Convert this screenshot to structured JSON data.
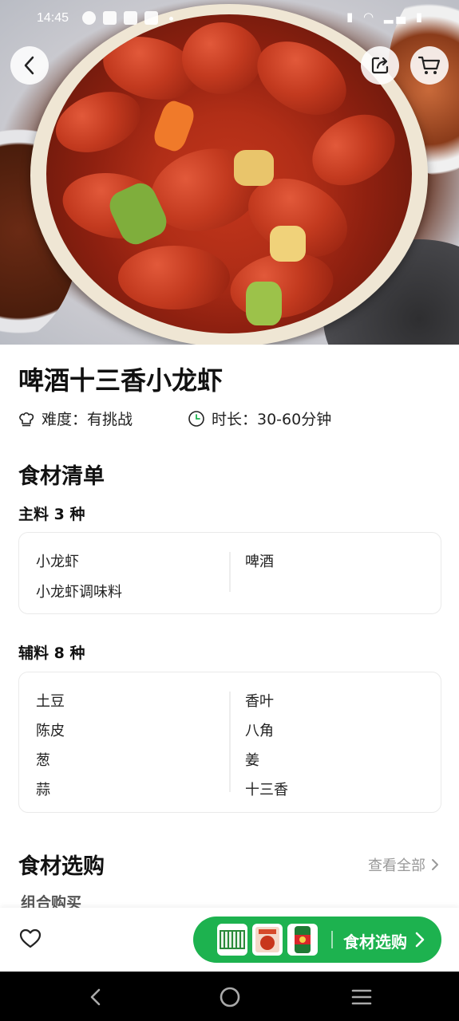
{
  "status_bar": {
    "time": "14:45"
  },
  "recipe": {
    "title": "啤酒十三香小龙虾",
    "difficulty_label": "难度：有挑战",
    "duration_label": "时长：30-60分钟"
  },
  "ingredients": {
    "section_title": "食材清单",
    "main": {
      "title": "主料 3 种",
      "items": [
        "小龙虾",
        "啤酒",
        "小龙虾调味料"
      ]
    },
    "auxiliary": {
      "title": "辅料 8 种",
      "items": [
        "土豆",
        "香叶",
        "陈皮",
        "八角",
        "葱",
        "姜",
        "蒜",
        "十三香"
      ]
    }
  },
  "shopping": {
    "section_title": "食材选购",
    "view_all": "查看全部",
    "subtitle": "组合购买"
  },
  "bottom_bar": {
    "buy_button_label": "食材选购",
    "accent_color": "#1db24f"
  },
  "icons": [
    "back-icon",
    "share-icon",
    "cart-icon",
    "chef-hat-icon",
    "clock-icon",
    "chevron-right-icon",
    "heart-icon",
    "nav-back-icon",
    "nav-home-icon",
    "nav-menu-icon"
  ]
}
